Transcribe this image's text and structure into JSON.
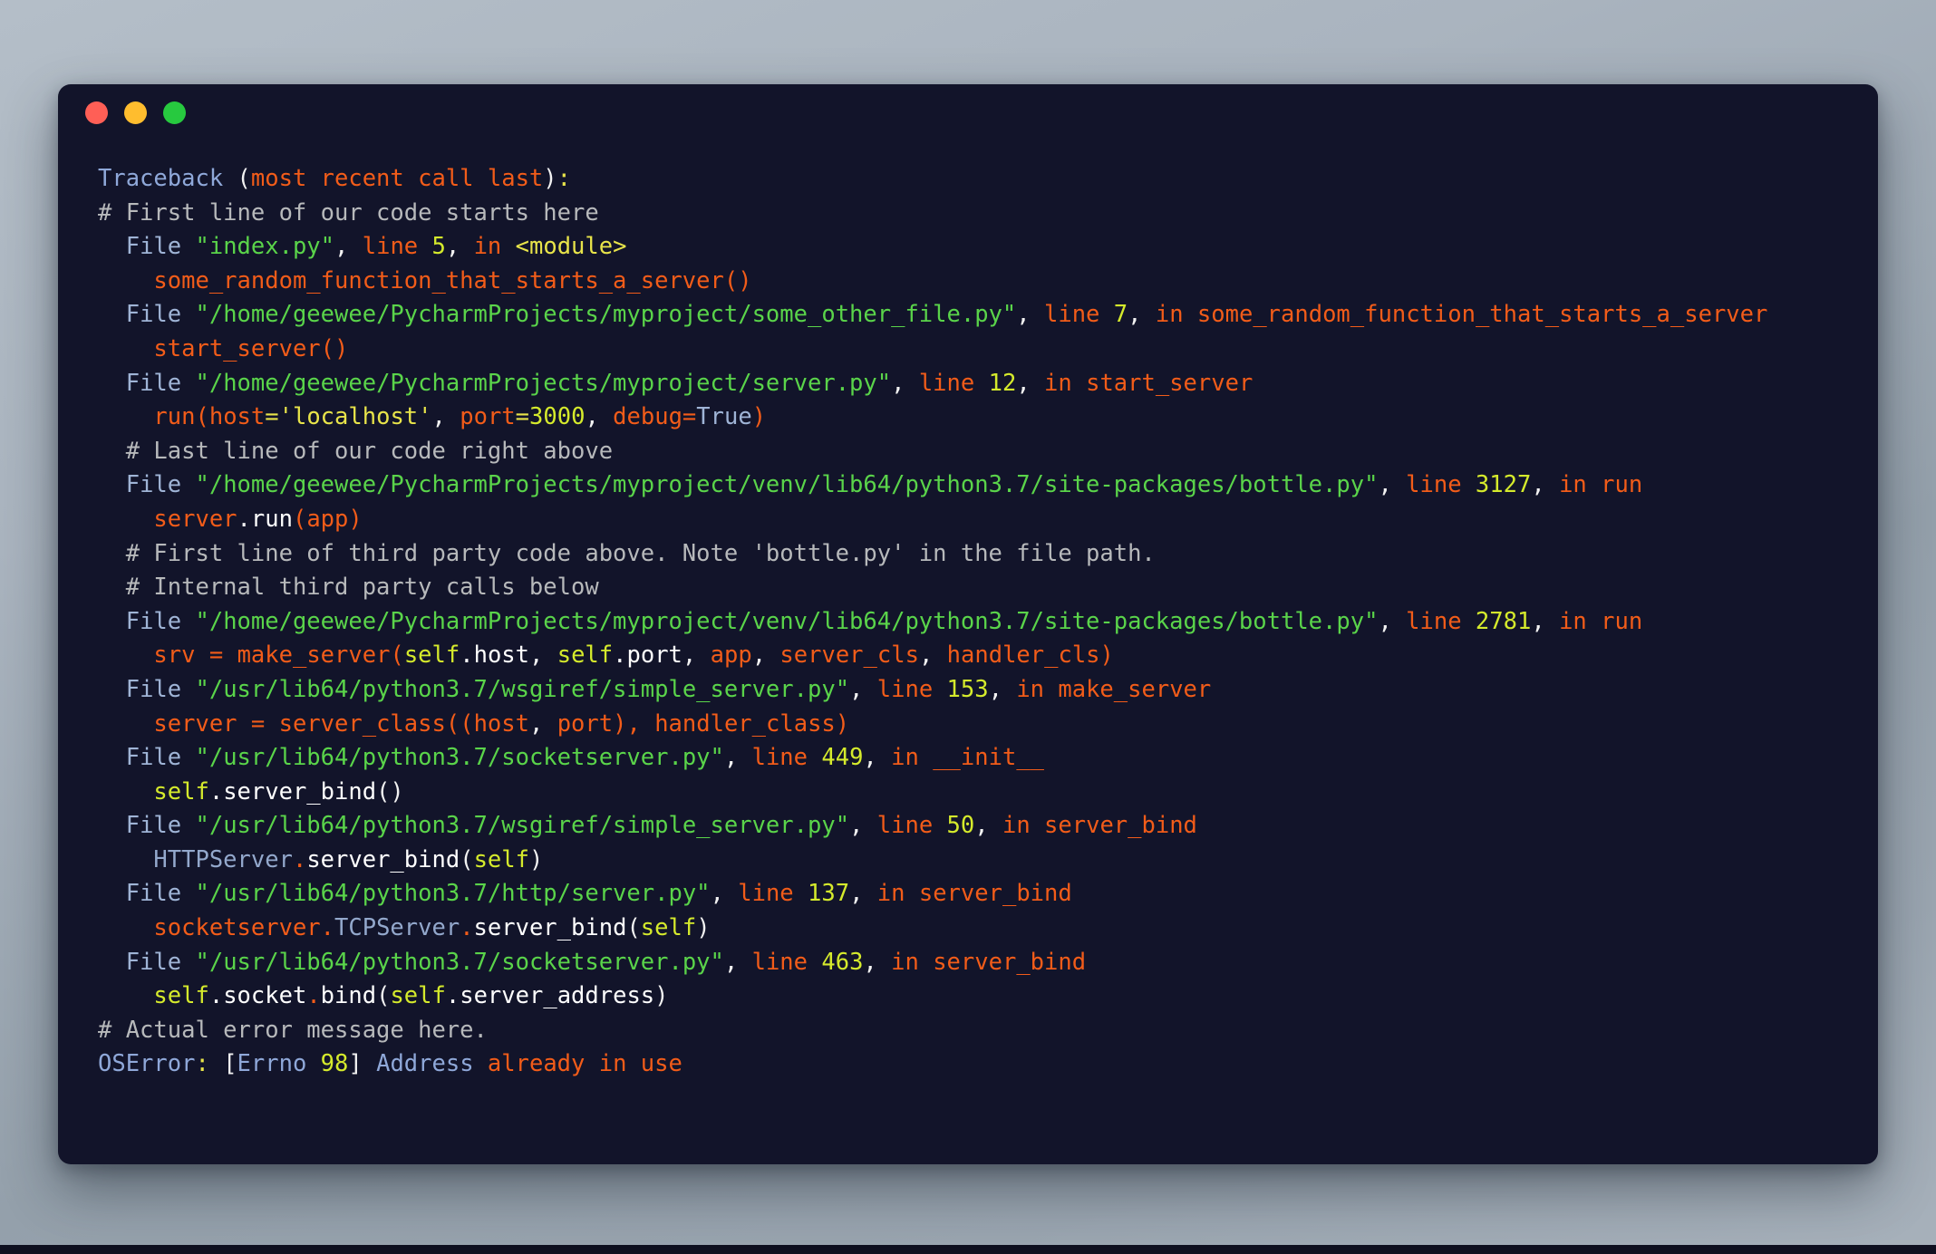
{
  "window": {
    "traffic_lights": [
      {
        "name": "close-button",
        "color": "#ff5f56",
        "label": ""
      },
      {
        "name": "minimize-button",
        "color": "#ffbd2e",
        "label": ""
      },
      {
        "name": "maximize-button",
        "color": "#27c93f",
        "label": ""
      }
    ]
  },
  "terminal": {
    "background": "#12142a",
    "lines": [
      {
        "indent": 0,
        "tokens": [
          {
            "t": "Traceback ",
            "c": "c-exc"
          },
          {
            "t": "(",
            "c": "c-punc"
          },
          {
            "t": "most recent call last",
            "c": "c-msg"
          },
          {
            "t": ")",
            "c": "c-punc"
          },
          {
            "t": ":",
            "c": "c-colon"
          }
        ]
      },
      {
        "indent": 0,
        "tokens": [
          {
            "t": "# First line of our code starts here",
            "c": "c-comment"
          }
        ]
      },
      {
        "indent": 1,
        "tokens": [
          {
            "t": "File ",
            "c": "c-file"
          },
          {
            "t": "\"index.py\"",
            "c": "c-path"
          },
          {
            "t": ", ",
            "c": "c-punc"
          },
          {
            "t": "line ",
            "c": "c-kw"
          },
          {
            "t": "5",
            "c": "c-num"
          },
          {
            "t": ", ",
            "c": "c-punc"
          },
          {
            "t": "in ",
            "c": "c-kw"
          },
          {
            "t": "<module>",
            "c": "c-fn"
          }
        ]
      },
      {
        "indent": 2,
        "tokens": [
          {
            "t": "some_random_function_that_starts_a_server",
            "c": "c-name"
          },
          {
            "t": "()",
            "c": "c-msg"
          }
        ]
      },
      {
        "indent": 1,
        "tokens": [
          {
            "t": "File ",
            "c": "c-file"
          },
          {
            "t": "\"/home/geewee/PycharmProjects/myproject/some_other_file.py\"",
            "c": "c-path"
          },
          {
            "t": ", ",
            "c": "c-punc"
          },
          {
            "t": "line ",
            "c": "c-kw"
          },
          {
            "t": "7",
            "c": "c-num"
          },
          {
            "t": ", ",
            "c": "c-punc"
          },
          {
            "t": "in ",
            "c": "c-kw"
          },
          {
            "t": "some_random_function_that_starts_a_server",
            "c": "c-name"
          }
        ]
      },
      {
        "indent": 2,
        "tokens": [
          {
            "t": "start_server",
            "c": "c-name"
          },
          {
            "t": "()",
            "c": "c-msg"
          }
        ]
      },
      {
        "indent": 1,
        "tokens": [
          {
            "t": "File ",
            "c": "c-file"
          },
          {
            "t": "\"/home/geewee/PycharmProjects/myproject/server.py\"",
            "c": "c-path"
          },
          {
            "t": ", ",
            "c": "c-punc"
          },
          {
            "t": "line ",
            "c": "c-kw"
          },
          {
            "t": "12",
            "c": "c-num"
          },
          {
            "t": ", ",
            "c": "c-punc"
          },
          {
            "t": "in ",
            "c": "c-kw"
          },
          {
            "t": "start_server",
            "c": "c-name"
          }
        ]
      },
      {
        "indent": 2,
        "tokens": [
          {
            "t": "run",
            "c": "c-name"
          },
          {
            "t": "(",
            "c": "c-msg"
          },
          {
            "t": "host",
            "c": "c-name"
          },
          {
            "t": "=",
            "c": "c-str"
          },
          {
            "t": "'localhost'",
            "c": "c-str"
          },
          {
            "t": ", ",
            "c": "c-punc"
          },
          {
            "t": "port",
            "c": "c-name"
          },
          {
            "t": "=",
            "c": "c-str"
          },
          {
            "t": "3000",
            "c": "c-num"
          },
          {
            "t": ", ",
            "c": "c-punc"
          },
          {
            "t": "debug",
            "c": "c-name"
          },
          {
            "t": "=",
            "c": "c-msg"
          },
          {
            "t": "True",
            "c": "c-true"
          },
          {
            "t": ")",
            "c": "c-msg"
          }
        ]
      },
      {
        "indent": 1,
        "tokens": [
          {
            "t": "# Last line of our code right above",
            "c": "c-comment"
          }
        ]
      },
      {
        "indent": 1,
        "tokens": [
          {
            "t": "File ",
            "c": "c-file"
          },
          {
            "t": "\"/home/geewee/PycharmProjects/myproject/venv/lib64/python3.7/site-packages/bottle.py\"",
            "c": "c-path"
          },
          {
            "t": ", ",
            "c": "c-punc"
          },
          {
            "t": "line ",
            "c": "c-kw"
          },
          {
            "t": "3127",
            "c": "c-num"
          },
          {
            "t": ", ",
            "c": "c-punc"
          },
          {
            "t": "in ",
            "c": "c-kw"
          },
          {
            "t": "run",
            "c": "c-name"
          }
        ]
      },
      {
        "indent": 2,
        "tokens": [
          {
            "t": "server",
            "c": "c-name"
          },
          {
            "t": ".",
            "c": "c-punc"
          },
          {
            "t": "run",
            "c": "c-attr"
          },
          {
            "t": "(",
            "c": "c-msg"
          },
          {
            "t": "app",
            "c": "c-name"
          },
          {
            "t": ")",
            "c": "c-msg"
          }
        ]
      },
      {
        "indent": 1,
        "tokens": [
          {
            "t": "# First line of third party code above. Note 'bottle.py' in the file path.",
            "c": "c-comment"
          }
        ]
      },
      {
        "indent": 1,
        "tokens": [
          {
            "t": "# Internal third party calls below",
            "c": "c-comment"
          }
        ]
      },
      {
        "indent": 1,
        "tokens": [
          {
            "t": "File ",
            "c": "c-file"
          },
          {
            "t": "\"/home/geewee/PycharmProjects/myproject/venv/lib64/python3.7/site-packages/bottle.py\"",
            "c": "c-path"
          },
          {
            "t": ", ",
            "c": "c-punc"
          },
          {
            "t": "line ",
            "c": "c-kw"
          },
          {
            "t": "2781",
            "c": "c-num"
          },
          {
            "t": ", ",
            "c": "c-punc"
          },
          {
            "t": "in ",
            "c": "c-kw"
          },
          {
            "t": "run",
            "c": "c-name"
          }
        ]
      },
      {
        "indent": 2,
        "tokens": [
          {
            "t": "srv ",
            "c": "c-name"
          },
          {
            "t": "= ",
            "c": "c-msg"
          },
          {
            "t": "make_server",
            "c": "c-name"
          },
          {
            "t": "(",
            "c": "c-msg"
          },
          {
            "t": "self",
            "c": "c-self"
          },
          {
            "t": ".host",
            "c": "c-attr"
          },
          {
            "t": ", ",
            "c": "c-punc"
          },
          {
            "t": "self",
            "c": "c-self"
          },
          {
            "t": ".port",
            "c": "c-attr"
          },
          {
            "t": ", ",
            "c": "c-punc"
          },
          {
            "t": "app",
            "c": "c-name"
          },
          {
            "t": ", ",
            "c": "c-punc"
          },
          {
            "t": "server_cls",
            "c": "c-name"
          },
          {
            "t": ", ",
            "c": "c-punc"
          },
          {
            "t": "handler_cls",
            "c": "c-name"
          },
          {
            "t": ")",
            "c": "c-msg"
          }
        ]
      },
      {
        "indent": 1,
        "tokens": [
          {
            "t": "File ",
            "c": "c-file"
          },
          {
            "t": "\"/usr/lib64/python3.7/wsgiref/simple_server.py\"",
            "c": "c-path"
          },
          {
            "t": ", ",
            "c": "c-punc"
          },
          {
            "t": "line ",
            "c": "c-kw"
          },
          {
            "t": "153",
            "c": "c-num"
          },
          {
            "t": ", ",
            "c": "c-punc"
          },
          {
            "t": "in ",
            "c": "c-kw"
          },
          {
            "t": "make_server",
            "c": "c-name"
          }
        ]
      },
      {
        "indent": 2,
        "tokens": [
          {
            "t": "server ",
            "c": "c-name"
          },
          {
            "t": "= ",
            "c": "c-msg"
          },
          {
            "t": "server_class",
            "c": "c-name"
          },
          {
            "t": "((",
            "c": "c-msg"
          },
          {
            "t": "host",
            "c": "c-name"
          },
          {
            "t": ", ",
            "c": "c-punc"
          },
          {
            "t": "port",
            "c": "c-name"
          },
          {
            "t": "), ",
            "c": "c-msg"
          },
          {
            "t": "handler_class",
            "c": "c-name"
          },
          {
            "t": ")",
            "c": "c-msg"
          }
        ]
      },
      {
        "indent": 1,
        "tokens": [
          {
            "t": "File ",
            "c": "c-file"
          },
          {
            "t": "\"/usr/lib64/python3.7/socketserver.py\"",
            "c": "c-path"
          },
          {
            "t": ", ",
            "c": "c-punc"
          },
          {
            "t": "line ",
            "c": "c-kw"
          },
          {
            "t": "449",
            "c": "c-num"
          },
          {
            "t": ", ",
            "c": "c-punc"
          },
          {
            "t": "in ",
            "c": "c-kw"
          },
          {
            "t": "__init__",
            "c": "c-name"
          }
        ]
      },
      {
        "indent": 2,
        "tokens": [
          {
            "t": "self",
            "c": "c-self"
          },
          {
            "t": ".server_bind",
            "c": "c-attr"
          },
          {
            "t": "()",
            "c": "c-punc"
          }
        ]
      },
      {
        "indent": 1,
        "tokens": [
          {
            "t": "File ",
            "c": "c-file"
          },
          {
            "t": "\"/usr/lib64/python3.7/wsgiref/simple_server.py\"",
            "c": "c-path"
          },
          {
            "t": ", ",
            "c": "c-punc"
          },
          {
            "t": "line ",
            "c": "c-kw"
          },
          {
            "t": "50",
            "c": "c-num"
          },
          {
            "t": ", ",
            "c": "c-punc"
          },
          {
            "t": "in ",
            "c": "c-kw"
          },
          {
            "t": "server_bind",
            "c": "c-name"
          }
        ]
      },
      {
        "indent": 2,
        "tokens": [
          {
            "t": "HTTPServer",
            "c": "c-cls"
          },
          {
            "t": ".",
            "c": "c-msg"
          },
          {
            "t": "server_bind",
            "c": "c-attr"
          },
          {
            "t": "(",
            "c": "c-punc"
          },
          {
            "t": "self",
            "c": "c-self"
          },
          {
            "t": ")",
            "c": "c-punc"
          }
        ]
      },
      {
        "indent": 1,
        "tokens": [
          {
            "t": "File ",
            "c": "c-file"
          },
          {
            "t": "\"/usr/lib64/python3.7/http/server.py\"",
            "c": "c-path"
          },
          {
            "t": ", ",
            "c": "c-punc"
          },
          {
            "t": "line ",
            "c": "c-kw"
          },
          {
            "t": "137",
            "c": "c-num"
          },
          {
            "t": ", ",
            "c": "c-punc"
          },
          {
            "t": "in ",
            "c": "c-kw"
          },
          {
            "t": "server_bind",
            "c": "c-name"
          }
        ]
      },
      {
        "indent": 2,
        "tokens": [
          {
            "t": "socketserver",
            "c": "c-name"
          },
          {
            "t": ".",
            "c": "c-msg"
          },
          {
            "t": "TCPServer",
            "c": "c-cls"
          },
          {
            "t": ".",
            "c": "c-msg"
          },
          {
            "t": "server_bind",
            "c": "c-attr"
          },
          {
            "t": "(",
            "c": "c-punc"
          },
          {
            "t": "self",
            "c": "c-self"
          },
          {
            "t": ")",
            "c": "c-punc"
          }
        ]
      },
      {
        "indent": 1,
        "tokens": [
          {
            "t": "File ",
            "c": "c-file"
          },
          {
            "t": "\"/usr/lib64/python3.7/socketserver.py\"",
            "c": "c-path"
          },
          {
            "t": ", ",
            "c": "c-punc"
          },
          {
            "t": "line ",
            "c": "c-kw"
          },
          {
            "t": "463",
            "c": "c-num"
          },
          {
            "t": ", ",
            "c": "c-punc"
          },
          {
            "t": "in ",
            "c": "c-kw"
          },
          {
            "t": "server_bind",
            "c": "c-name"
          }
        ]
      },
      {
        "indent": 2,
        "tokens": [
          {
            "t": "self",
            "c": "c-self"
          },
          {
            "t": ".socket",
            "c": "c-attr"
          },
          {
            "t": ".",
            "c": "c-msg"
          },
          {
            "t": "bind",
            "c": "c-attr"
          },
          {
            "t": "(",
            "c": "c-punc"
          },
          {
            "t": "self",
            "c": "c-self"
          },
          {
            "t": ".server_address",
            "c": "c-attr"
          },
          {
            "t": ")",
            "c": "c-punc"
          }
        ]
      },
      {
        "indent": 0,
        "tokens": [
          {
            "t": "# Actual error message here.",
            "c": "c-comment"
          }
        ]
      },
      {
        "indent": 0,
        "tokens": [
          {
            "t": "OSError",
            "c": "c-exc"
          },
          {
            "t": ": ",
            "c": "c-colon"
          },
          {
            "t": "[",
            "c": "c-punc"
          },
          {
            "t": "Errno ",
            "c": "c-exc"
          },
          {
            "t": "98",
            "c": "c-num"
          },
          {
            "t": "]",
            "c": "c-punc"
          },
          {
            "t": " Address ",
            "c": "c-exc"
          },
          {
            "t": "already in use",
            "c": "c-msg"
          }
        ]
      }
    ]
  }
}
